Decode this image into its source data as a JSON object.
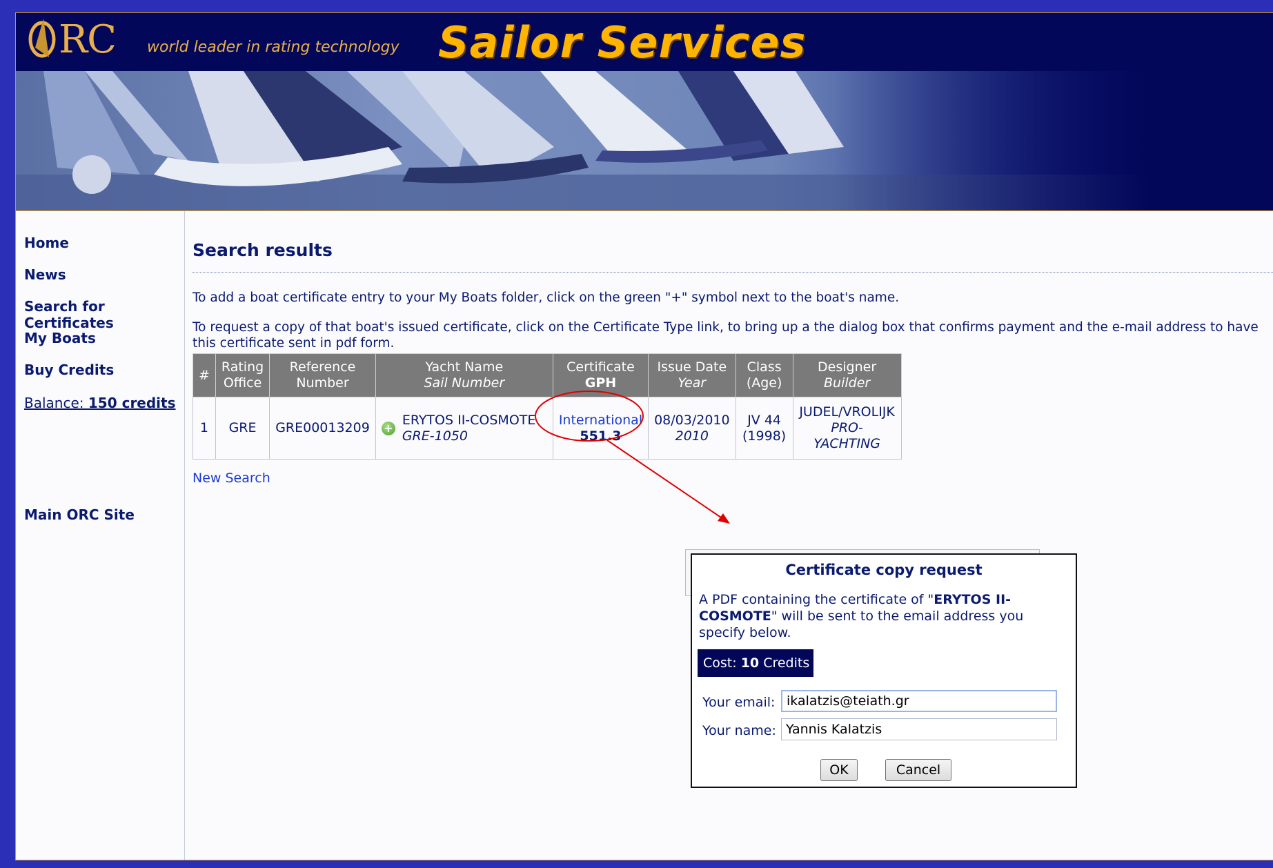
{
  "header": {
    "logo_rc": "RC",
    "tagline": "world leader in rating technology",
    "title": "Sailor Services"
  },
  "sidebar": {
    "items": [
      {
        "label": "Home"
      },
      {
        "label": "News"
      },
      {
        "label": "Search for Certificates"
      },
      {
        "label": "My Boats"
      },
      {
        "label": "Buy Credits"
      }
    ],
    "balance_label": "Balance:",
    "balance_value": "150 credits",
    "main_site": "Main ORC Site"
  },
  "main": {
    "title": "Search results",
    "para1": "To add a boat certificate entry to your My Boats folder, click on the green \"+\" symbol next to the boat's name.",
    "para2": "To request a copy of that boat's issued certificate, click on the Certificate Type link, to bring up a the dialog box that confirms payment and the e-mail address to have this certificate sent in pdf form.",
    "table": {
      "headers": [
        {
          "top": "#",
          "bottom": ""
        },
        {
          "top": "Rating",
          "bottom": "Office"
        },
        {
          "top": "Reference",
          "bottom": "Number"
        },
        {
          "top": "Yacht Name",
          "bottom": "Sail Number"
        },
        {
          "top": "Certificate",
          "bottom": "GPH"
        },
        {
          "top": "Issue Date",
          "bottom": "Year"
        },
        {
          "top": "Class",
          "bottom": "(Age)"
        },
        {
          "top": "Designer",
          "bottom": "Builder"
        }
      ],
      "row": {
        "num": "1",
        "office": "GRE",
        "reference": "GRE00013209",
        "yacht_name": "ERYTOS II-COSMOTE",
        "sail_number": "GRE-1050",
        "cert_type": "International",
        "gph": "551.3",
        "issue_date": "08/03/2010",
        "year": "2010",
        "class": "JV 44",
        "age": "(1998)",
        "designer": "JUDEL/VROLIJK",
        "builder": "PRO-YACHTING"
      }
    },
    "new_search": "New Search"
  },
  "dialog": {
    "title": "Certificate copy request",
    "msg_prefix": "A PDF containing the certificate of \"",
    "msg_boat": "ERYTOS II-COSMOTE",
    "msg_suffix": "\" will be sent to the email address you specify below.",
    "cost_label": "Cost:",
    "cost_value": "10",
    "cost_unit": "Credits",
    "email_label": "Your email:",
    "email_value": "ikalatzis@teiath.gr",
    "name_label": "Your name:",
    "name_value": "Yannis Kalatzis",
    "ok_label": "OK",
    "cancel_label": "Cancel"
  },
  "colors": {
    "outer_bg": "#2b2fb8",
    "header_bg": "#03075a",
    "title_gold": "#ffb400",
    "text_navy": "#0a1a6e",
    "link_blue": "#1a3ad0",
    "annotation_red": "#e00000"
  }
}
